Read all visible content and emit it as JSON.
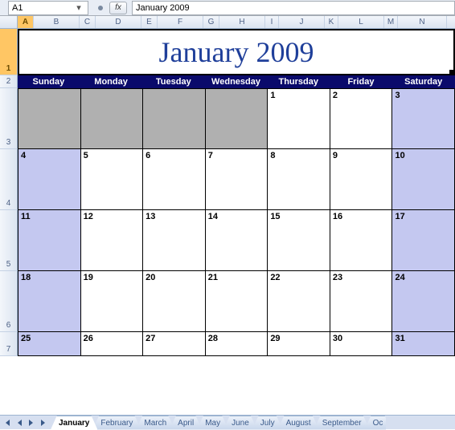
{
  "formula_bar": {
    "name_box": "A1",
    "fx_label": "fx",
    "formula_value": "January 2009"
  },
  "columns": [
    "A",
    "B",
    "C",
    "D",
    "E",
    "F",
    "G",
    "H",
    "I",
    "J",
    "K",
    "L",
    "M",
    "N"
  ],
  "selected_column_index": 0,
  "rows": [
    "1",
    "2",
    "3",
    "4",
    "5",
    "6",
    "7"
  ],
  "selected_row_index": 0,
  "title": "January 2009",
  "days_of_week": [
    "Sunday",
    "Monday",
    "Tuesday",
    "Wednesday",
    "Thursday",
    "Friday",
    "Saturday"
  ],
  "tabs": [
    "January",
    "February",
    "March",
    "April",
    "May",
    "June",
    "July",
    "August",
    "September",
    "Oc"
  ],
  "active_tab": 0,
  "chart_data": {
    "type": "table",
    "title": "January 2009",
    "note": "Monthly calendar grid; Jan 1 2009 falls on Thursday",
    "weeks": [
      [
        {
          "n": "",
          "t": "inactive"
        },
        {
          "n": "",
          "t": "inactive"
        },
        {
          "n": "",
          "t": "inactive"
        },
        {
          "n": "",
          "t": "inactive"
        },
        {
          "n": "1",
          "t": ""
        },
        {
          "n": "2",
          "t": ""
        },
        {
          "n": "3",
          "t": "weekend"
        }
      ],
      [
        {
          "n": "4",
          "t": "weekend"
        },
        {
          "n": "5",
          "t": ""
        },
        {
          "n": "6",
          "t": ""
        },
        {
          "n": "7",
          "t": ""
        },
        {
          "n": "8",
          "t": ""
        },
        {
          "n": "9",
          "t": ""
        },
        {
          "n": "10",
          "t": "weekend"
        }
      ],
      [
        {
          "n": "11",
          "t": "weekend"
        },
        {
          "n": "12",
          "t": ""
        },
        {
          "n": "13",
          "t": ""
        },
        {
          "n": "14",
          "t": ""
        },
        {
          "n": "15",
          "t": ""
        },
        {
          "n": "16",
          "t": ""
        },
        {
          "n": "17",
          "t": "weekend"
        }
      ],
      [
        {
          "n": "18",
          "t": "weekend"
        },
        {
          "n": "19",
          "t": ""
        },
        {
          "n": "20",
          "t": ""
        },
        {
          "n": "21",
          "t": ""
        },
        {
          "n": "22",
          "t": ""
        },
        {
          "n": "23",
          "t": ""
        },
        {
          "n": "24",
          "t": "weekend"
        }
      ],
      [
        {
          "n": "25",
          "t": "weekend"
        },
        {
          "n": "26",
          "t": ""
        },
        {
          "n": "27",
          "t": ""
        },
        {
          "n": "28",
          "t": ""
        },
        {
          "n": "29",
          "t": ""
        },
        {
          "n": "30",
          "t": ""
        },
        {
          "n": "31",
          "t": "weekend"
        }
      ]
    ]
  }
}
